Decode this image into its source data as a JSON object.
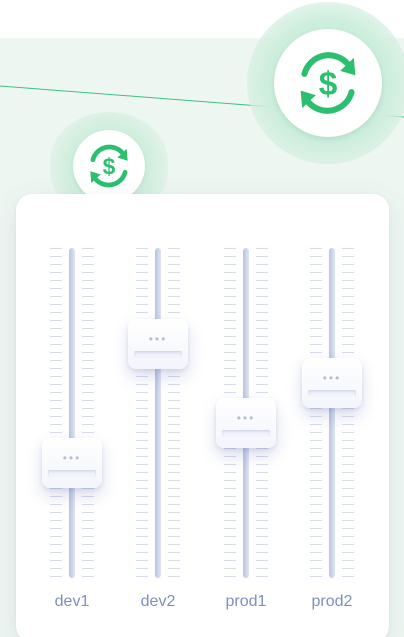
{
  "coins": [
    {
      "icon": "dollar-exchange-icon",
      "size": "large"
    },
    {
      "icon": "dollar-exchange-icon",
      "size": "small"
    }
  ],
  "colors": {
    "accent_green": "#2cbf70",
    "label_text": "#7f8fbf",
    "track": "#c9d1ea",
    "backdrop": "#eef6f1"
  },
  "mixer": {
    "channels": [
      {
        "label": "dev1",
        "level": 0.35
      },
      {
        "label": "dev2",
        "level": 0.71
      },
      {
        "label": "prod1",
        "level": 0.47
      },
      {
        "label": "prod2",
        "level": 0.59
      }
    ]
  },
  "knob_glyph": "•••"
}
